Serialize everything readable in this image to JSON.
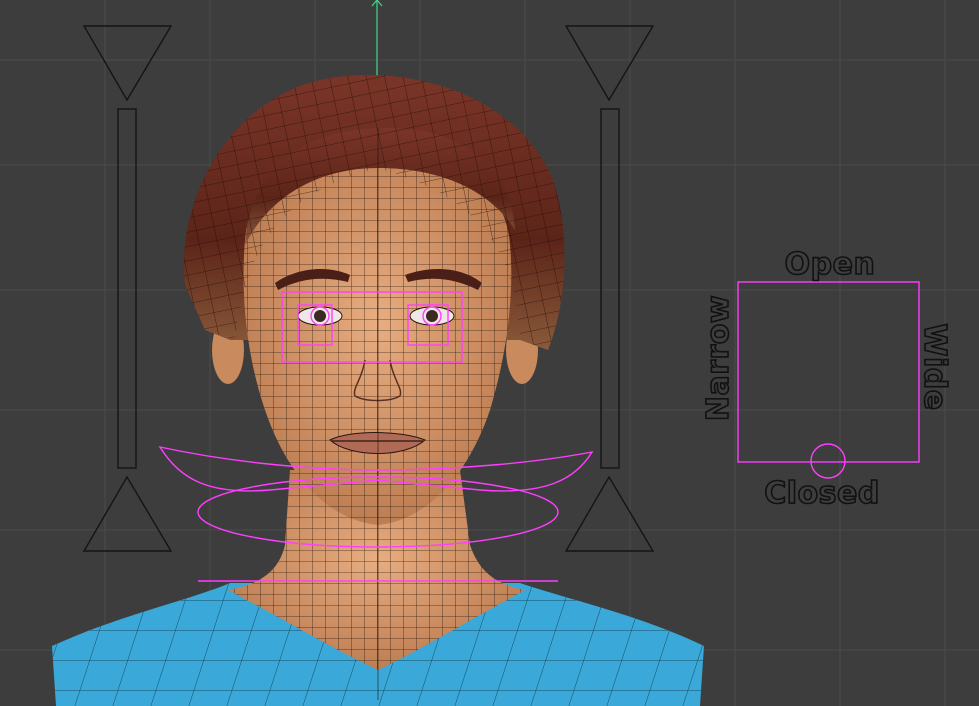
{
  "viewport": {
    "background": "#3d3d3d",
    "grid_color": "#4a4a4a",
    "y_axis_color": "#3fd98a",
    "rig_color": "#ff3fff",
    "widget_outline_color": "#141414"
  },
  "mouth_widget": {
    "top_label": "Open",
    "bottom_label": "Closed",
    "left_label": "Narrow",
    "right_label": "Wide"
  },
  "character": {
    "skin_color": "#d89a6e",
    "hair_color": "#6a2e22",
    "shirt_color": "#3aa8d8",
    "wireframe_color": "#1a1009"
  },
  "left_eyelid_slider": {
    "top_handle": "triangle-down-icon",
    "bottom_handle": "triangle-up-icon"
  },
  "right_eyelid_slider": {
    "top_handle": "triangle-down-icon",
    "bottom_handle": "triangle-up-icon"
  }
}
